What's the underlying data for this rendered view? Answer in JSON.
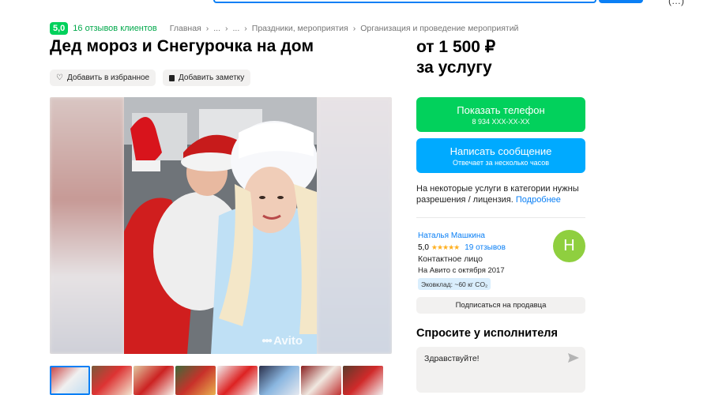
{
  "header": {
    "right_fragment": "(…)"
  },
  "rating": {
    "score": "5,0",
    "reviews": "16 отзывов клиентов"
  },
  "breadcrumbs": [
    "Главная",
    "...",
    "...",
    "Праздники, мероприятия",
    "Организация и проведение мероприятий"
  ],
  "listing": {
    "title": "Дед мороз и Снегурочка на дом",
    "favorite_label": "Добавить в избранное",
    "note_label": "Добавить заметку",
    "watermark": "Avito"
  },
  "price": {
    "line1": "от 1 500 ₽",
    "line2": "за услугу"
  },
  "contact": {
    "show_phone": "Показать телефон",
    "phone_masked": "8 934 XXX-XX-XX",
    "write_message": "Написать сообщение",
    "response_time": "Отвечает за несколько часов"
  },
  "license": {
    "text": "На некоторые услуги в категории нужны разрешения / лицензия.",
    "link": "Подробнее"
  },
  "seller": {
    "name": "Наталья Машкина",
    "rating": "5,0",
    "stars": "★★★★★",
    "reviews": "19 отзывов",
    "role": "Контактное лицо",
    "since": "На Авито с октября 2017",
    "eco": "Эковклад: ~60 кг CO₂",
    "avatar_letter": "Н",
    "subscribe": "Подписаться на продавца"
  },
  "ask": {
    "title": "Спросите у исполнителя",
    "input_value": "Здравствуйте!"
  },
  "colors": {
    "green": "#02d15c",
    "blue": "#00aaff",
    "link": "#0a7ff5"
  },
  "thumbnails_count": 8
}
